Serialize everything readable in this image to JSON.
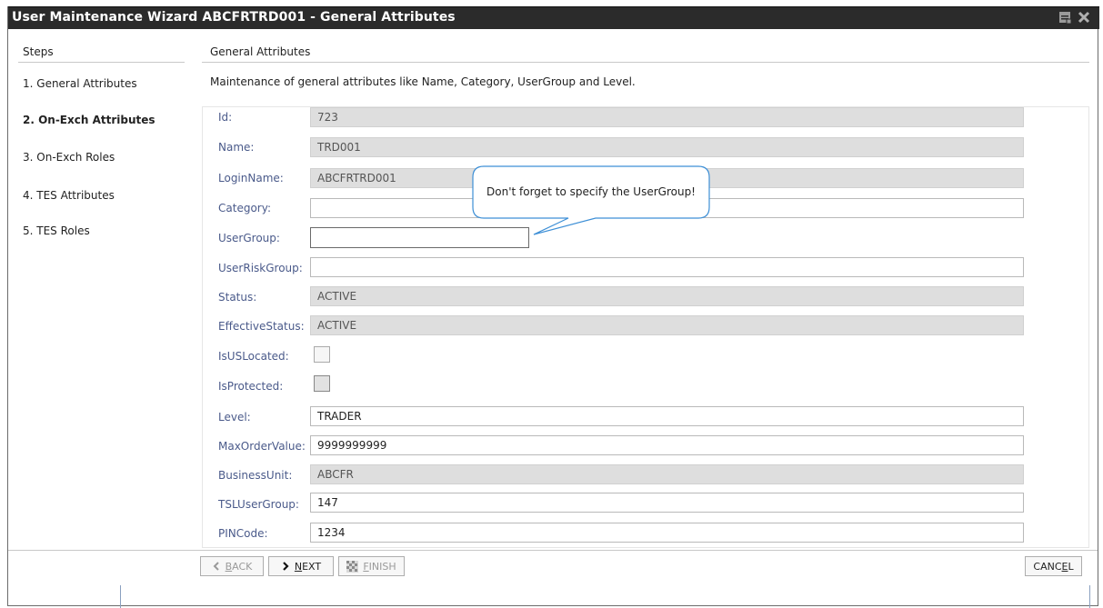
{
  "window": {
    "title": "User Maintenance Wizard ABCFRTRD001 - General Attributes"
  },
  "steps": {
    "header": "Steps",
    "items": [
      {
        "label": "1. General Attributes"
      },
      {
        "label": "2. On-Exch Attributes"
      },
      {
        "label": "3. On-Exch Roles"
      },
      {
        "label": "4. TES Attributes"
      },
      {
        "label": "5. TES Roles"
      }
    ],
    "active_index": 1
  },
  "main": {
    "header": "General Attributes",
    "description": "Maintenance of general attributes like Name, Category, UserGroup and Level."
  },
  "form": {
    "fields": [
      {
        "label": "Id:",
        "value": "723",
        "readonly": true
      },
      {
        "label": "Name:",
        "value": "TRD001",
        "readonly": true
      },
      {
        "label": "LoginName:",
        "value": "ABCFRTRD001",
        "readonly": true
      },
      {
        "label": "Category:",
        "value": "",
        "readonly": false
      },
      {
        "label": "UserGroup:",
        "value": "",
        "readonly": false
      },
      {
        "label": "UserRiskGroup:",
        "value": "",
        "readonly": false
      },
      {
        "label": "Status:",
        "value": "ACTIVE",
        "readonly": true
      },
      {
        "label": "EffectiveStatus:",
        "value": "ACTIVE",
        "readonly": true
      },
      {
        "label": "IsUSLocated:",
        "checked": false
      },
      {
        "label": "IsProtected:",
        "checked": false
      },
      {
        "label": "Level:",
        "value": "TRADER",
        "readonly": false
      },
      {
        "label": "MaxOrderValue:",
        "value": "9999999999",
        "readonly": false
      },
      {
        "label": "BusinessUnit:",
        "value": "ABCFR",
        "readonly": true
      },
      {
        "label": "TSLUserGroup:",
        "value": "147",
        "readonly": false
      },
      {
        "label": "PINCode:",
        "value": "1234",
        "readonly": false
      }
    ]
  },
  "callout": {
    "text": "Don't forget to specify the UserGroup!"
  },
  "buttons": {
    "back": {
      "label_pre": "",
      "label_ul": "B",
      "label_post": "ACK",
      "enabled": false
    },
    "next": {
      "label_pre": "",
      "label_ul": "N",
      "label_post": "EXT",
      "enabled": true
    },
    "finish": {
      "label_pre": "",
      "label_ul": "F",
      "label_post": "INISH",
      "enabled": false
    },
    "cancel": {
      "label_pre": "CANC",
      "label_ul": "E",
      "label_post": "L",
      "enabled": true
    }
  },
  "colors": {
    "titlebar": "#2b2b2b",
    "label": "#4a5a8a",
    "callout_border": "#3d8fd6"
  }
}
